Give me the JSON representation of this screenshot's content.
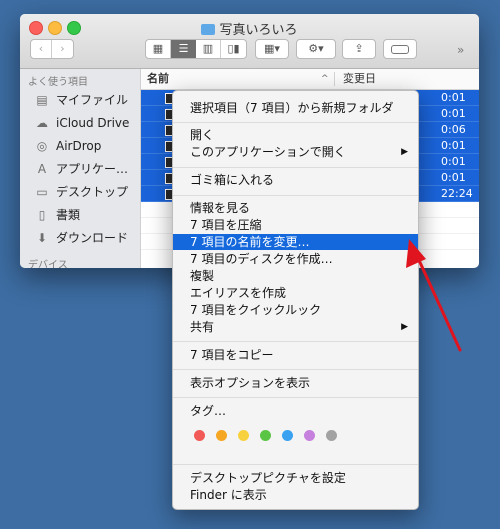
{
  "window": {
    "title": "写真いろいろ",
    "view_modes": [
      "grid-icon",
      "list-icon",
      "columns-icon",
      "coverflow-icon"
    ],
    "overflow": "»"
  },
  "sidebar": {
    "section_favorites": "よく使う項目",
    "items": [
      {
        "label": "マイファイル",
        "icon": "all-files-icon"
      },
      {
        "label": "iCloud Drive",
        "icon": "cloud-icon"
      },
      {
        "label": "AirDrop",
        "icon": "airdrop-icon"
      },
      {
        "label": "アプリケー…",
        "icon": "applications-icon"
      },
      {
        "label": "デスクトップ",
        "icon": "desktop-icon"
      },
      {
        "label": "書類",
        "icon": "documents-icon"
      },
      {
        "label": "ダウンロード",
        "icon": "downloads-icon"
      }
    ],
    "section_devices": "デバイス"
  },
  "list": {
    "col_name": "名前",
    "col_date": "変更日",
    "times": [
      "0:01",
      "0:01",
      "0:06",
      "0:01",
      "0:01",
      "0:01",
      "22:24"
    ]
  },
  "context_menu": {
    "new_folder": "選択項目（7 項目）から新規フォルダ",
    "open": "開く",
    "open_with": "このアプリケーションで開く",
    "trash": "ゴミ箱に入れる",
    "get_info": "情報を見る",
    "compress": "7 項目を圧縮",
    "rename": "7 項目の名前を変更…",
    "burn": "7 項目のディスクを作成…",
    "duplicate": "複製",
    "alias": "エイリアスを作成",
    "quicklook": "7 項目をクイックルック",
    "share": "共有",
    "copy": "7 項目をコピー",
    "view_options": "表示オプションを表示",
    "tags": "タグ…",
    "tag_colors": [
      "#f15a56",
      "#f5a623",
      "#f7d23e",
      "#5ac444",
      "#3aa2f0",
      "#c680dd",
      "#a2a2a2"
    ],
    "set_desktop": "デスクトップピクチャを設定",
    "show_in_finder": "Finder に表示"
  },
  "annotation_color": "#e0141e"
}
